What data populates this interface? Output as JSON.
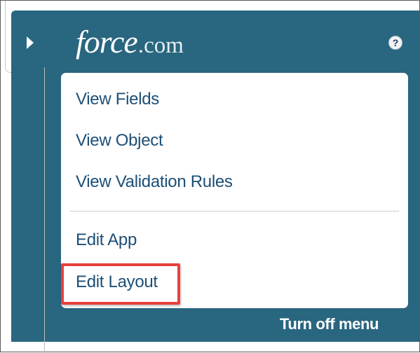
{
  "header": {
    "logo_main": "force",
    "logo_suffix": ".com",
    "help_symbol": "?",
    "expand_icon": "triangle-right-icon",
    "help_icon": "question-circle-icon"
  },
  "menu": {
    "items": [
      {
        "label": "View Fields"
      },
      {
        "label": "View Object"
      },
      {
        "label": "View Validation Rules"
      },
      {
        "label": "Edit App"
      },
      {
        "label": "Edit Layout"
      }
    ],
    "highlighted_item": "Edit Layout"
  },
  "footer": {
    "turn_off_label": "Turn off menu"
  },
  "colors": {
    "panel": "#29667f",
    "link": "#1d4f77",
    "highlight": "#e8403f"
  }
}
